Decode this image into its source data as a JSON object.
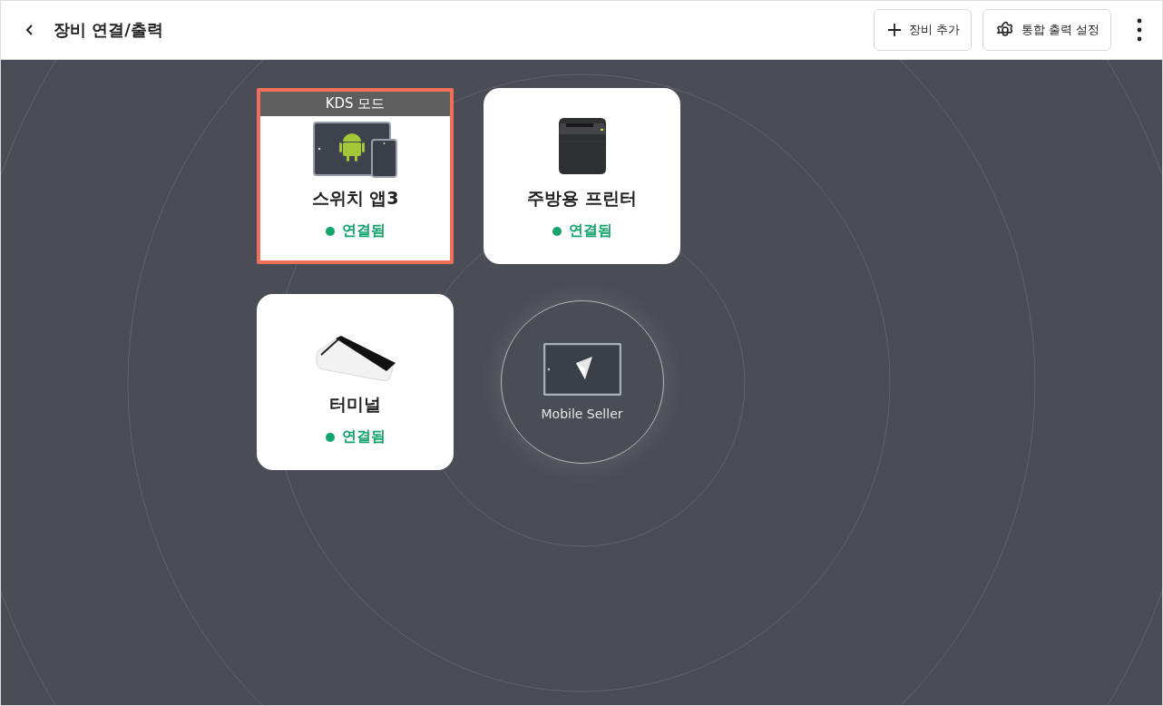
{
  "header": {
    "title": "장비 연결/출력",
    "buttons": [
      {
        "kind": "add",
        "label": "장비 추가"
      },
      {
        "kind": "settings",
        "label": "통합 출력 설정"
      }
    ]
  },
  "devices": [
    {
      "kind": "tablet",
      "name": "스위치 앱3",
      "status": "연결됨",
      "connected": true,
      "selected": true,
      "badge": "KDS 모드"
    },
    {
      "kind": "printer",
      "name": "주방용 프린터",
      "status": "연결됨",
      "connected": true,
      "selected": false
    },
    {
      "kind": "terminal",
      "name": "터미널",
      "status": "연결됨",
      "connected": true,
      "selected": false
    }
  ],
  "hub": {
    "label": "Mobile Seller"
  }
}
